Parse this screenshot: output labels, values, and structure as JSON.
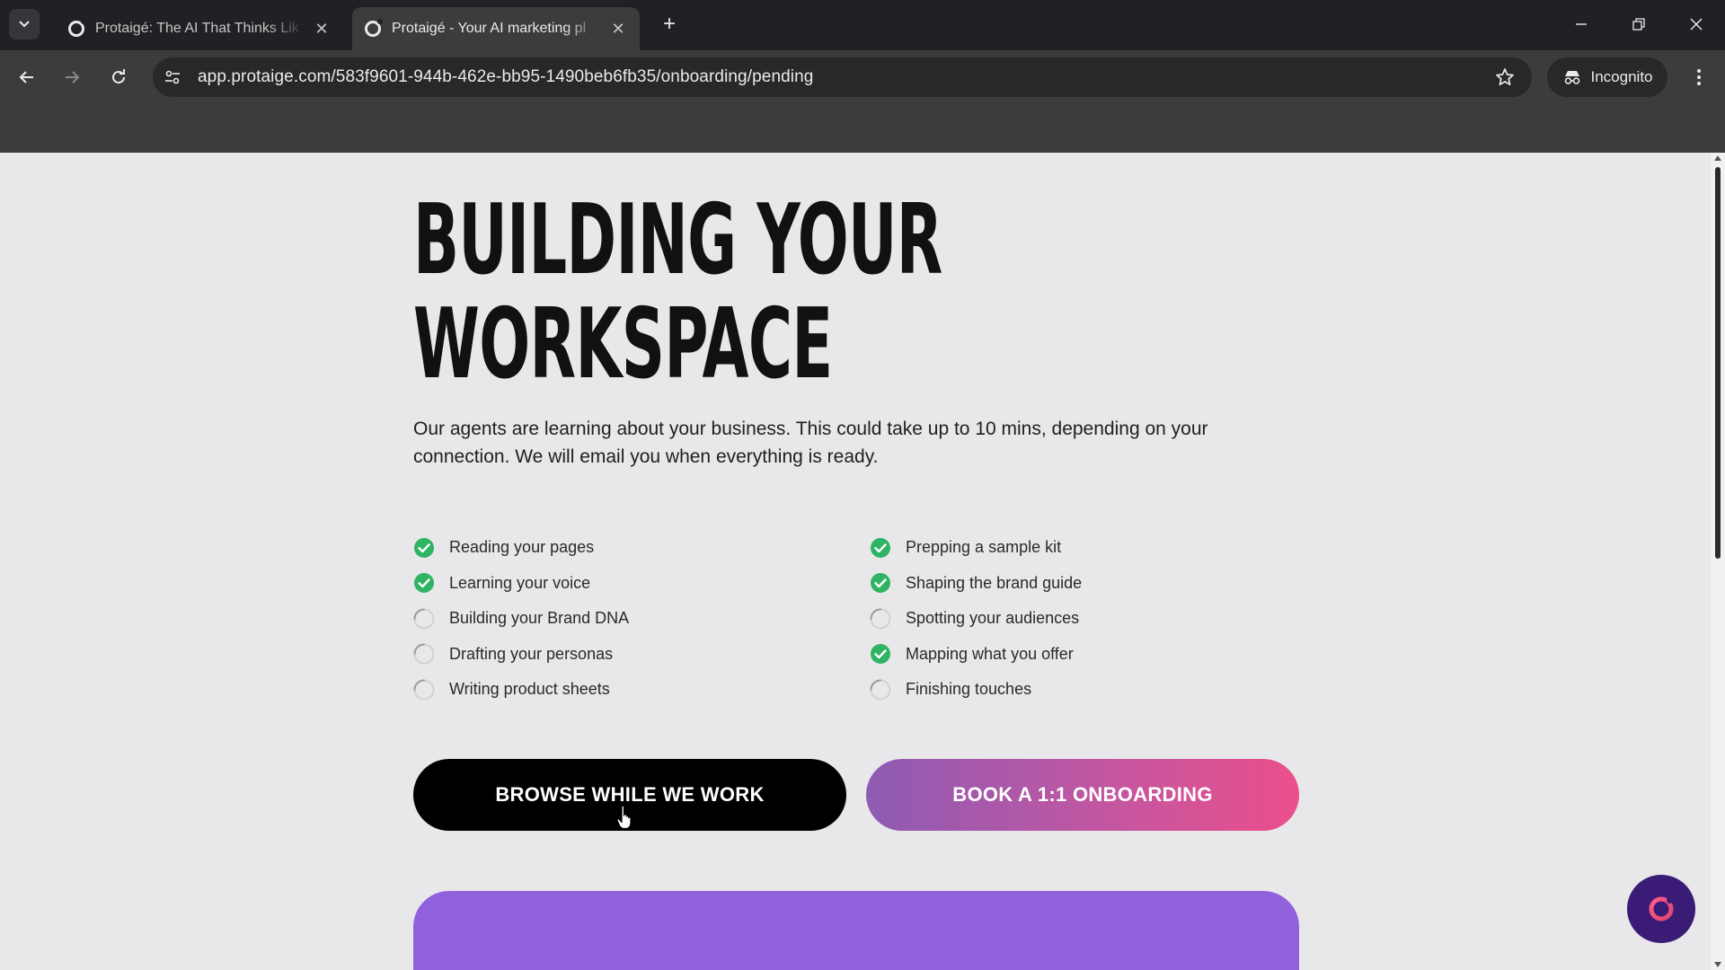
{
  "browser": {
    "tabs": [
      {
        "title": "Protaigé: The AI That Thinks Lik",
        "active": false
      },
      {
        "title": "Protaigé - Your AI marketing pl",
        "active": true
      }
    ],
    "url": "app.protaige.com/583f9601-944b-462e-bb95-1490beb6fb35/onboarding/pending",
    "incognito_label": "Incognito"
  },
  "page": {
    "headline": [
      "BUILDING YOUR",
      "WORKSPACE"
    ],
    "intro": "Our agents are learning about your business. This could take up to 10 mins, depending on your connection. We will email you when everything is ready.",
    "checklist": {
      "left": [
        {
          "label": "Reading your pages",
          "status": "done"
        },
        {
          "label": "Learning your voice",
          "status": "done"
        },
        {
          "label": "Building your Brand DNA",
          "status": "pending"
        },
        {
          "label": "Drafting your personas",
          "status": "pending"
        },
        {
          "label": "Writing product sheets",
          "status": "pending"
        }
      ],
      "right": [
        {
          "label": "Prepping a sample kit",
          "status": "done"
        },
        {
          "label": "Shaping the brand guide",
          "status": "done"
        },
        {
          "label": "Spotting your audiences",
          "status": "pending"
        },
        {
          "label": "Mapping what you offer",
          "status": "done"
        },
        {
          "label": "Finishing touches",
          "status": "pending"
        }
      ]
    },
    "buttons": {
      "browse": "BROWSE WHILE WE WORK",
      "book": "BOOK A 1:1 ONBOARDING"
    }
  },
  "colors": {
    "done_check": "#2fb463",
    "pending_ring": "#9a9a9a",
    "book_gradient_start": "#8e5bb3",
    "book_gradient_end": "#ec4f8b",
    "promo_card": "#9160dc",
    "chat_bubble": "#3a1c77"
  },
  "icons": {
    "done": "check-circle-icon",
    "pending": "spinner-ring-icon"
  }
}
